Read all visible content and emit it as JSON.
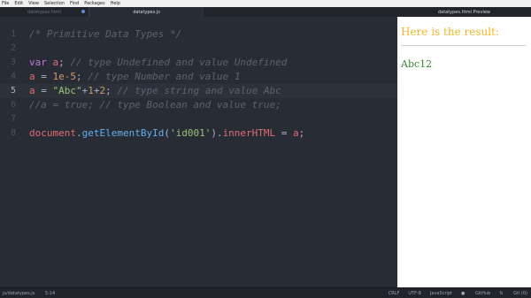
{
  "menu": [
    "File",
    "Edit",
    "View",
    "Selection",
    "Find",
    "Packages",
    "Help"
  ],
  "tabs": {
    "html_tab": "datatypes.html",
    "js_tab": "datatypes.js",
    "preview_tab": "datatypes.html Preview"
  },
  "code": [
    {
      "num": "1",
      "tokens": [
        {
          "t": "/* Primitive Data Types */",
          "c": "comment"
        }
      ]
    },
    {
      "num": "2",
      "tokens": []
    },
    {
      "num": "3",
      "tokens": [
        {
          "t": "var",
          "c": "kw"
        },
        {
          "t": " a",
          "c": "var"
        },
        {
          "t": "; ",
          "c": "plain"
        },
        {
          "t": "// type Undefined and value Undefined",
          "c": "comment"
        }
      ]
    },
    {
      "num": "4",
      "tokens": [
        {
          "t": "a",
          "c": "var"
        },
        {
          "t": " = ",
          "c": "plain"
        },
        {
          "t": "1e-5",
          "c": "num"
        },
        {
          "t": "; ",
          "c": "plain"
        },
        {
          "t": "// type Number and value 1",
          "c": "comment"
        }
      ]
    },
    {
      "num": "5",
      "tokens": [
        {
          "t": "a",
          "c": "var"
        },
        {
          "t": " = ",
          "c": "plain"
        },
        {
          "t": "\"Abc\"",
          "c": "str"
        },
        {
          "t": "+",
          "c": "plain"
        },
        {
          "t": "1",
          "c": "num"
        },
        {
          "t": "+",
          "c": "plain"
        },
        {
          "t": "2",
          "c": "num"
        },
        {
          "t": "; ",
          "c": "plain"
        },
        {
          "t": "// type string and value Abc",
          "c": "comment"
        }
      ]
    },
    {
      "num": "6",
      "tokens": [
        {
          "t": "//a = true; // type Boolean and value true;",
          "c": "comment"
        }
      ]
    },
    {
      "num": "7",
      "tokens": []
    },
    {
      "num": "8",
      "tokens": [
        {
          "t": "document",
          "c": "var"
        },
        {
          "t": ".",
          "c": "plain"
        },
        {
          "t": "getElementById",
          "c": "fn"
        },
        {
          "t": "(",
          "c": "plain"
        },
        {
          "t": "'id001'",
          "c": "str"
        },
        {
          "t": ").",
          "c": "plain"
        },
        {
          "t": "innerHTML",
          "c": "var"
        },
        {
          "t": " = ",
          "c": "plain"
        },
        {
          "t": "a",
          "c": "var"
        },
        {
          "t": ";",
          "c": "plain"
        }
      ]
    }
  ],
  "active_line": "5",
  "preview": {
    "heading": "Here is the result:",
    "result": "Abc12"
  },
  "status": {
    "file": "js/datatypes.js",
    "cursor": "5:14",
    "line_ending": "CRLF",
    "encoding": "UTF-8",
    "grammar": "JavaScript",
    "github": "GitHub",
    "git": "Git (0)"
  }
}
